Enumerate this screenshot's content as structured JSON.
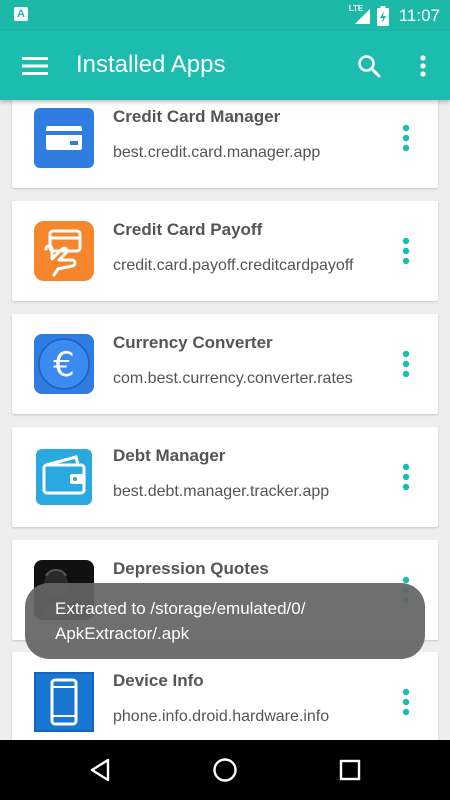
{
  "status_bar": {
    "left_icon_text": "A",
    "network_label": "LTE",
    "time": "11:07",
    "icons": [
      "notification-icon",
      "signal-icon",
      "battery-charging-icon"
    ]
  },
  "app_bar": {
    "title": "Installed Apps",
    "icons": [
      "menu-icon",
      "search-icon",
      "more-vert-icon"
    ]
  },
  "apps": [
    {
      "name": "Credit Card Manager",
      "package": "best.credit.card.manager.app",
      "icon": "credit-card-icon",
      "color": "#2f7de1"
    },
    {
      "name": "Credit Card Payoff",
      "package": "credit.card.payoff.creditcardpayoff",
      "icon": "hand-card-icon",
      "color": "#f5862b"
    },
    {
      "name": "Currency Converter",
      "package": "com.best.currency.converter.rates",
      "icon": "euro-icon",
      "color": "#2f7de1"
    },
    {
      "name": "Debt Manager",
      "package": "best.debt.manager.tracker.app",
      "icon": "wallet-icon",
      "color": "#29a9e0"
    },
    {
      "name": "Depression Quotes",
      "package": "",
      "icon": "portrait-icon",
      "color": "#111111"
    },
    {
      "name": "Device Info",
      "package": "phone.info.droid.hardware.info",
      "icon": "phone-icon",
      "color": "#1565c0"
    }
  ],
  "toast": {
    "message": "Extracted to /storage/emulated/0/ ApkExtractor/.apk"
  },
  "nav_bar": {
    "icons": [
      "back-icon",
      "home-icon",
      "recents-icon"
    ]
  },
  "colors": {
    "primary": "#1cbdae",
    "status_bar": "#1cb9a9",
    "accent": "#1cbdae",
    "background": "#eeeeee"
  }
}
